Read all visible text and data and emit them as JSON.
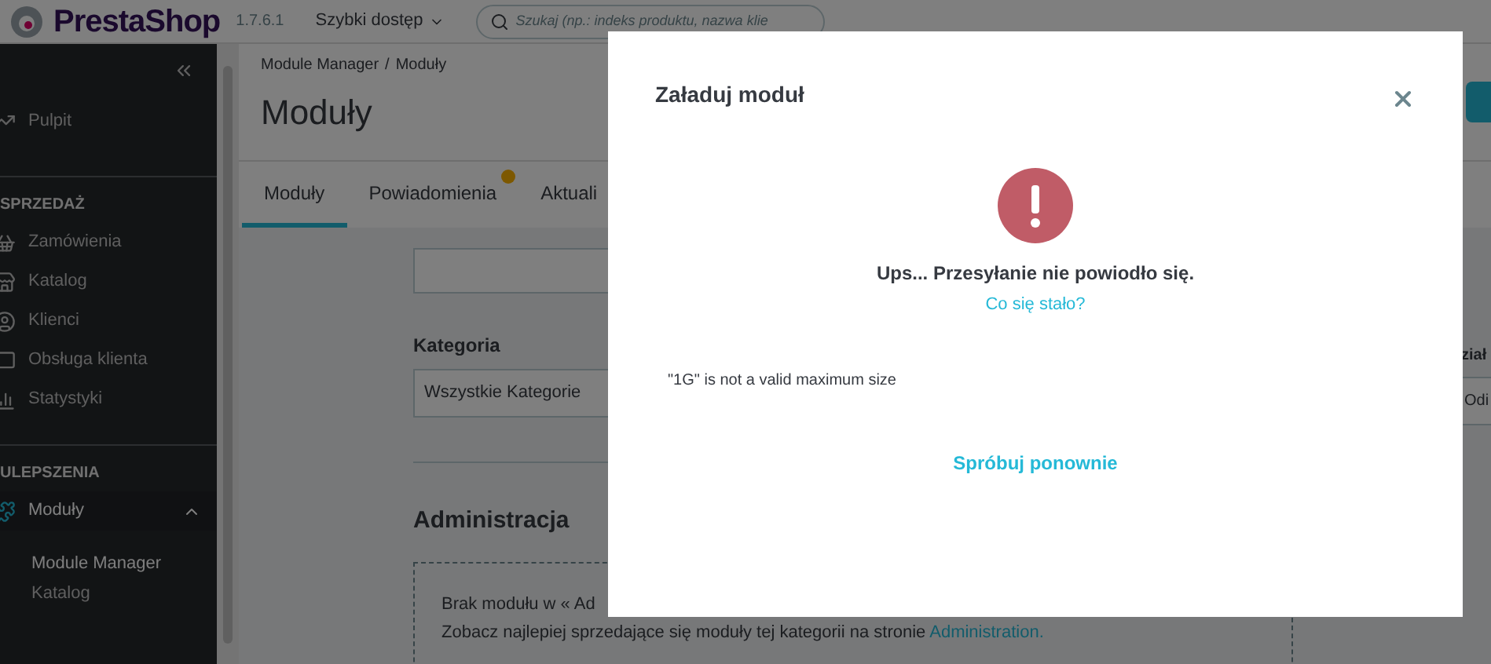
{
  "header": {
    "brand": "PrestaShop",
    "version": "1.7.6.1",
    "quick_access": "Szybki dostęp",
    "search": {
      "placeholder": "Szukaj (np.: indeks produktu, nazwa klie"
    }
  },
  "sidebar": {
    "top_item": "Pulpit",
    "sections": [
      {
        "title": "SPRZEDAŻ",
        "items": [
          {
            "label": "Zamówienia",
            "expanded": false
          },
          {
            "label": "Katalog",
            "expanded": false
          },
          {
            "label": "Klienci",
            "expanded": false
          },
          {
            "label": "Obsługa klienta",
            "expanded": false
          },
          {
            "label": "Statystyki",
            "expanded": false
          }
        ]
      },
      {
        "title": "ULEPSZENIA",
        "items": [
          {
            "label": "Moduły",
            "expanded": true,
            "children": [
              {
                "label": "Module Manager",
                "selected": true
              },
              {
                "label": "Katalog",
                "selected": false
              }
            ]
          }
        ]
      }
    ]
  },
  "breadcrumb": [
    "Module Manager",
    "/",
    "Moduły"
  ],
  "page_title": "Moduły",
  "tabs": [
    {
      "label": "Moduły",
      "selected": true,
      "badge": false
    },
    {
      "label": "Powiadomienia",
      "selected": false,
      "badge": true
    },
    {
      "label": "Aktuali",
      "selected": false,
      "badge": false
    }
  ],
  "filters": {
    "category_label": "Kategoria",
    "category_value": "Wszystkie Kategorie",
    "column_2_label": "ział",
    "column_2_value": "Odi"
  },
  "section": {
    "title": "Administracja",
    "empty_line_1": "Brak modułu w « Ad",
    "empty_line_2": "Zobacz najlepiej sprzedające się moduły tej kategorii na stronie",
    "empty_link": "Administration."
  },
  "modal": {
    "title": "Załaduj moduł",
    "message": "Ups... Przesyłanie nie powiodło się.",
    "help_link": "Co się stało?",
    "error": "\"1G\" is not a valid maximum size",
    "retry": "Spróbuj ponownie"
  }
}
